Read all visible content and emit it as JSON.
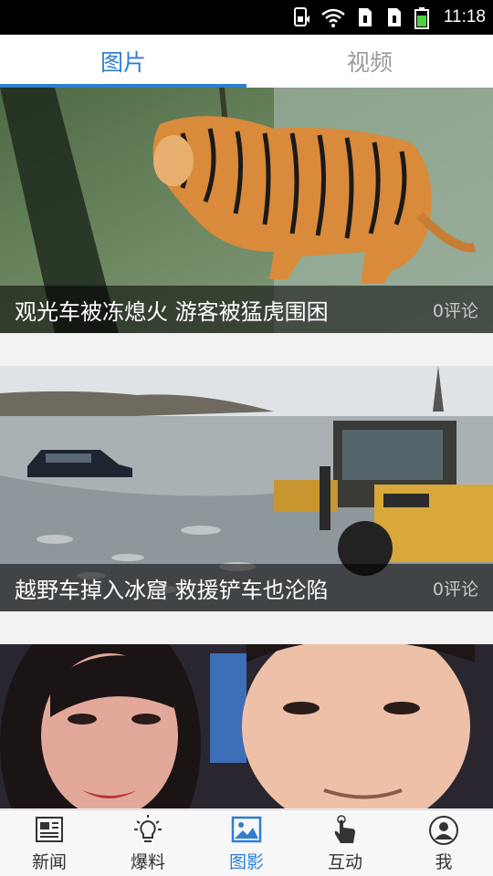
{
  "status_bar": {
    "time": "11:18",
    "icons": [
      "sim-card-icon",
      "wifi-icon",
      "sim-1-icon",
      "sim-2-icon",
      "battery-icon"
    ]
  },
  "tabs": [
    {
      "label": "图片",
      "active": true
    },
    {
      "label": "视频",
      "active": false
    }
  ],
  "feed": [
    {
      "title": "观光车被冻熄火 游客被猛虎围困",
      "comments": "0评论",
      "image": "tiger-photo"
    },
    {
      "title": "越野车掉入冰窟 救援铲车也沦陷",
      "comments": "0评论",
      "image": "frozen-lake-loader-photo"
    },
    {
      "title": "",
      "comments": "",
      "image": "couple-selfie-photo"
    }
  ],
  "bottom_nav": [
    {
      "label": "新闻",
      "icon": "newspaper-icon",
      "active": false
    },
    {
      "label": "爆料",
      "icon": "lightbulb-icon",
      "active": false
    },
    {
      "label": "图影",
      "icon": "picture-icon",
      "active": true
    },
    {
      "label": "互动",
      "icon": "touch-hand-icon",
      "active": false
    },
    {
      "label": "我",
      "icon": "user-profile-icon",
      "active": false
    }
  ],
  "colors": {
    "accent": "#2f7fd0",
    "inactive_tab": "#9a9a9a",
    "status_bar": "#000000"
  }
}
